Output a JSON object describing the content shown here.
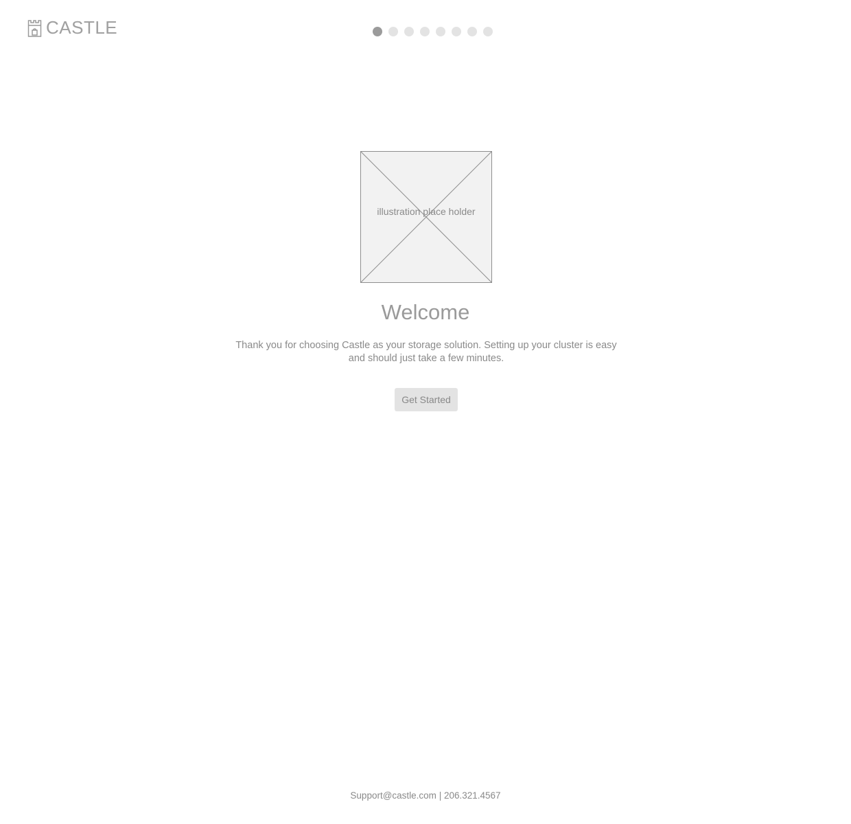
{
  "header": {
    "logo_text": "CASTLE",
    "logo_icon": "castle-icon"
  },
  "progress": {
    "total_steps": 8,
    "current_step": 1
  },
  "main": {
    "illustration_label": "illustration place holder",
    "title": "Welcome",
    "description": "Thank you for choosing Castle as your storage solution. Setting up your cluster is easy and should just take a few minutes.",
    "cta_label": "Get Started"
  },
  "footer": {
    "email": "Support@castle.com",
    "separator": "|",
    "phone": "206.321.4567"
  },
  "colors": {
    "text": "#888888",
    "dot_active": "#9b9b9b",
    "dot_inactive": "#e3e3e3",
    "button_bg": "#e3e3e3",
    "placeholder_bg": "#f2f2f2"
  }
}
